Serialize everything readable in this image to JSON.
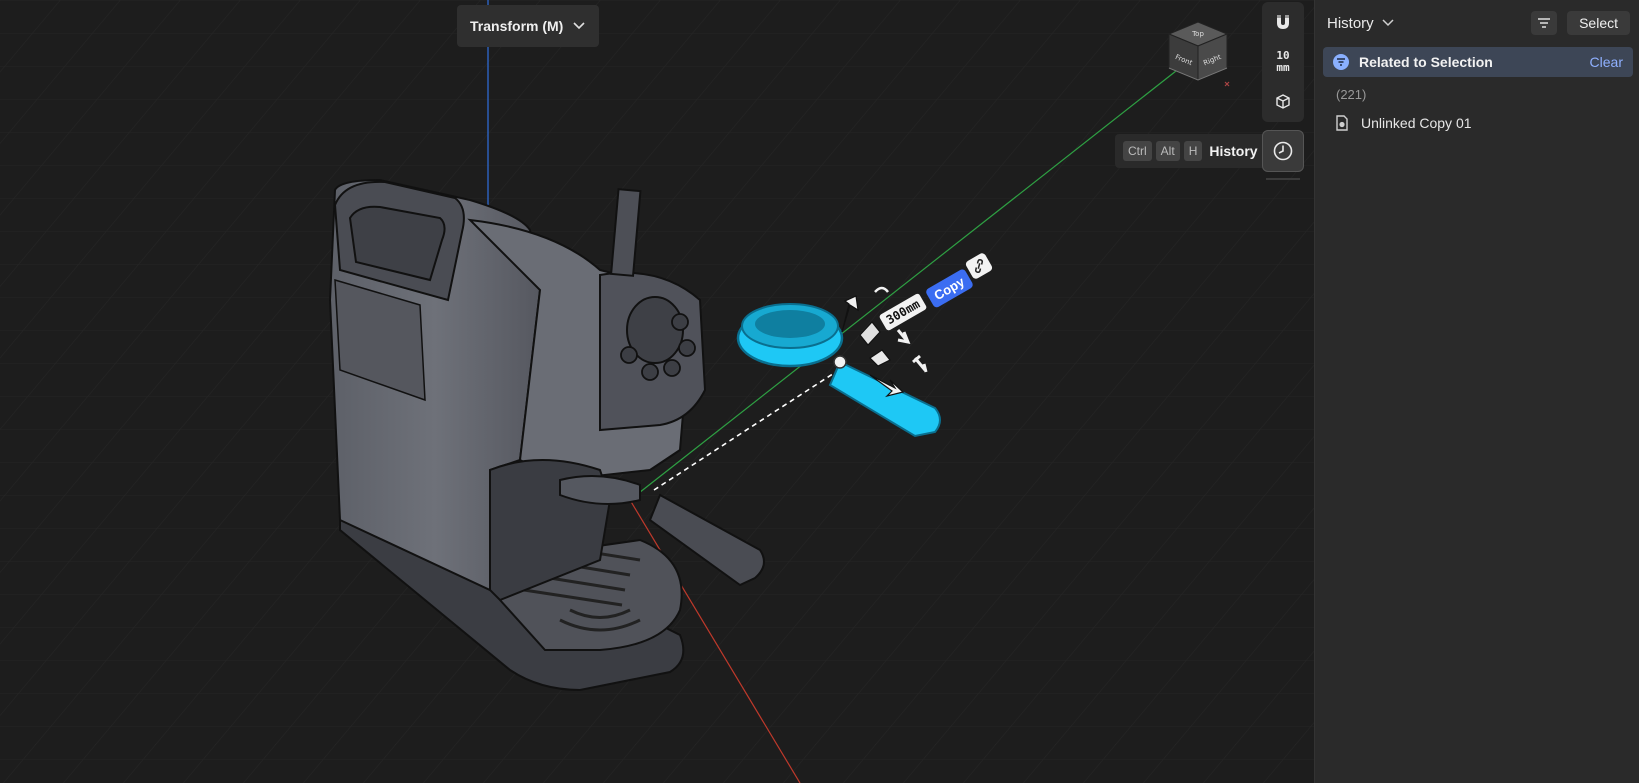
{
  "toolbar": {
    "transform_label": "Transform (M)",
    "grid_size_value": "10",
    "grid_size_unit": "mm"
  },
  "viewcube": {
    "top": "Top",
    "front": "Front",
    "right": "Right"
  },
  "tooltip": {
    "keys": [
      "Ctrl",
      "Alt",
      "H"
    ],
    "label": "History"
  },
  "gizmo": {
    "dimension": "300mm",
    "copy_label": "Copy"
  },
  "panel": {
    "title": "History",
    "select_label": "Select",
    "related_label": "Related to Selection",
    "clear_label": "Clear",
    "count": "(221)",
    "items": [
      {
        "label": "Unlinked Copy 01",
        "icon": "component-icon"
      }
    ]
  },
  "colors": {
    "accent": "#3b6df2",
    "selection": "#1ec8f5",
    "axis_x": "#c0392b",
    "axis_y": "#2ea043",
    "axis_z": "#2f6fde"
  }
}
